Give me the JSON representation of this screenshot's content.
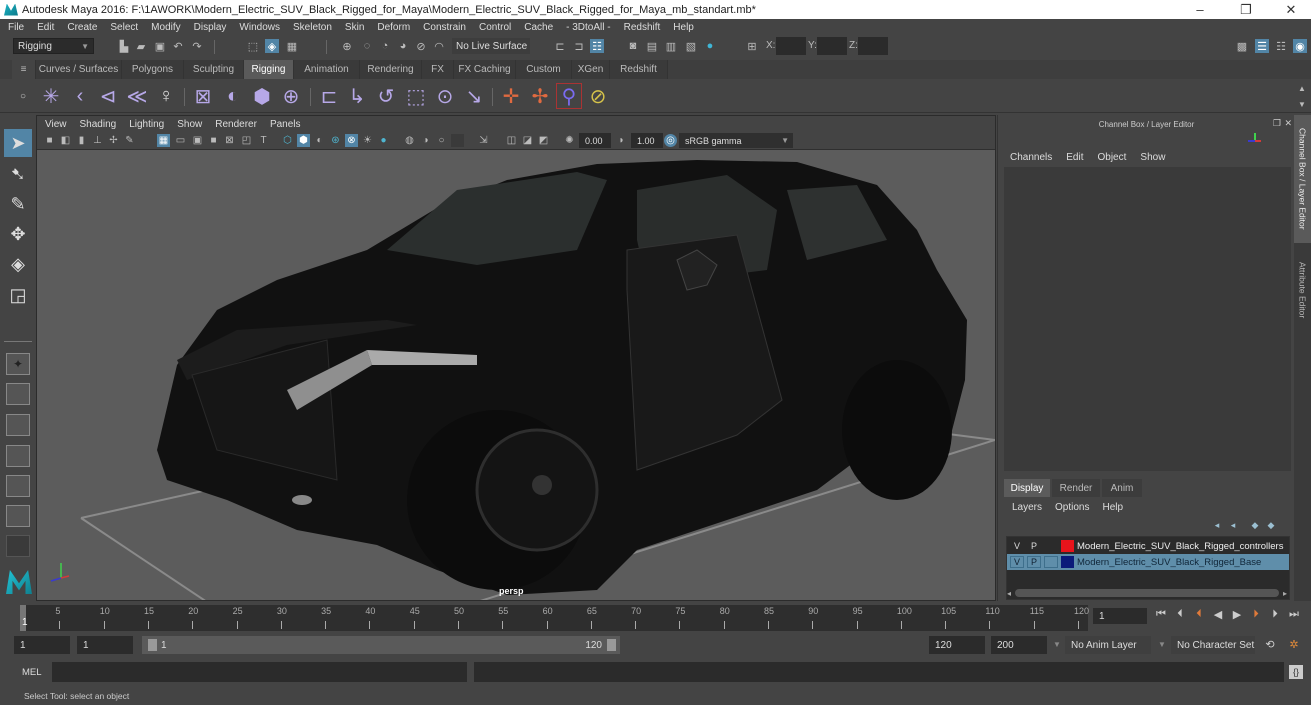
{
  "window": {
    "title": "Autodesk Maya 2016: F:\\1AWORK\\Modern_Electric_SUV_Black_Rigged_for_Maya\\Modern_Electric_SUV_Black_Rigged_for_Maya_mb_standart.mb*",
    "minimize": "–",
    "restore": "❐",
    "close": "✕"
  },
  "menubar": [
    "File",
    "Edit",
    "Create",
    "Select",
    "Modify",
    "Display",
    "Windows",
    "Skeleton",
    "Skin",
    "Deform",
    "Constrain",
    "Control",
    "Cache",
    "- 3DtoAll -",
    "Redshift",
    "Help"
  ],
  "statusline": {
    "menuset": "Rigging",
    "live_surface": "No Live Surface",
    "x_label": "X:",
    "y_label": "Y:",
    "z_label": "Z:",
    "x_value": "",
    "y_value": "",
    "z_value": ""
  },
  "shelf": {
    "tabs": [
      "Curves / Surfaces",
      "Polygons",
      "Sculpting",
      "Rigging",
      "Animation",
      "Rendering",
      "FX",
      "FX Caching",
      "Custom",
      "XGen",
      "Redshift"
    ],
    "active_tab": "Rigging",
    "tools": [
      "joint",
      "ik-handle",
      "ik-spline",
      "insert-joint",
      "hik-skeleton",
      "bind-skin",
      "smooth-bind",
      "lattice",
      "cluster",
      "parent-constraint",
      "point-constraint",
      "orient-constraint",
      "scale-constraint",
      "aim-constraint",
      "pole-vector-constraint",
      "locator",
      "pin",
      "sculpt-deformer",
      "blend-shape"
    ]
  },
  "viewport": {
    "menu": [
      "View",
      "Shading",
      "Lighting",
      "Show",
      "Renderer",
      "Panels"
    ],
    "exposure": "0.00",
    "gamma": "1.00",
    "color_space": "sRGB gamma",
    "camera_label": "persp"
  },
  "channel_box": {
    "title": "Channel Box / Layer Editor",
    "menu": [
      "Channels",
      "Edit",
      "Object",
      "Show"
    ]
  },
  "layer_editor": {
    "tabs": [
      "Display",
      "Render",
      "Anim"
    ],
    "active_tab": "Display",
    "menu": [
      "Layers",
      "Options",
      "Help"
    ],
    "layers": [
      {
        "v": "V",
        "p": "P",
        "color": "#e8141b",
        "name": "Modern_Electric_SUV_Black_Rigged_controllers",
        "selected": false
      },
      {
        "v": "V",
        "p": "P",
        "color": "#0b1a7a",
        "name": "Modern_Electric_SUV_Black_Rigged_Base",
        "selected": true
      }
    ]
  },
  "side_tabs": [
    "Channel Box / Layer Editor",
    "Attribute Editor"
  ],
  "timeline": {
    "ticks": [
      "5",
      "10",
      "15",
      "20",
      "25",
      "30",
      "35",
      "40",
      "45",
      "50",
      "55",
      "60",
      "65",
      "70",
      "75",
      "80",
      "85",
      "90",
      "95",
      "100",
      "105",
      "110",
      "115",
      "120"
    ],
    "current_frame_marker": "1",
    "current_frame": "1",
    "playback_controls": [
      "go-to-start",
      "step-back-key",
      "step-back-frame",
      "play-backward",
      "play-forward",
      "step-forward-frame",
      "step-forward-key",
      "go-to-end"
    ]
  },
  "range": {
    "start": "1",
    "playback_start": "1",
    "slider_start": "1",
    "slider_end": "120",
    "playback_end": "120",
    "end": "200",
    "anim_layer": "No Anim Layer",
    "character_set": "No Character Set"
  },
  "command_line": {
    "label": "MEL",
    "value": ""
  },
  "help_line": "Select Tool: select an object"
}
